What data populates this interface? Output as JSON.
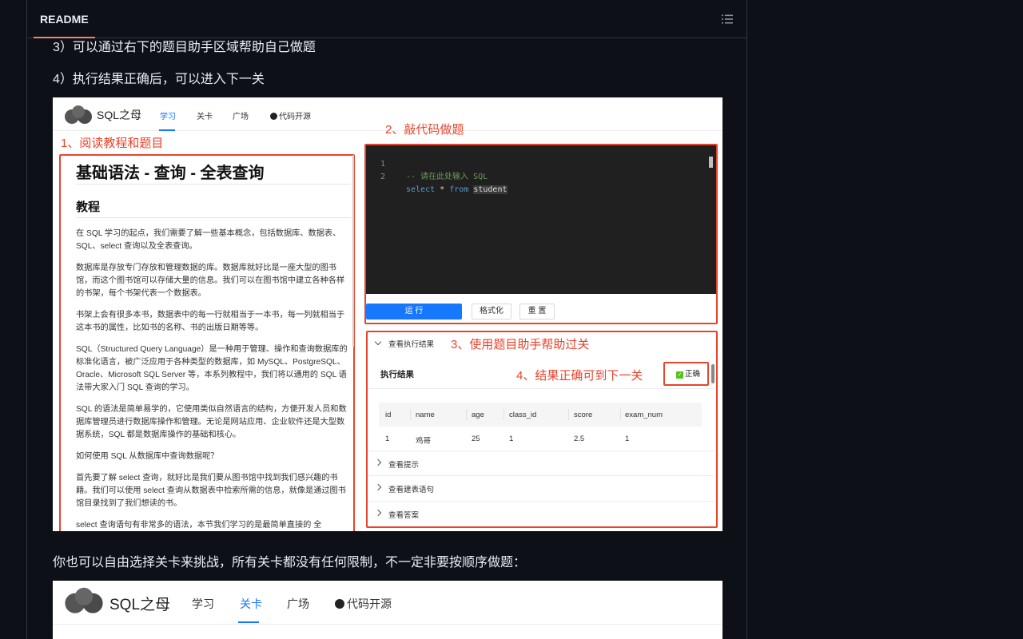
{
  "header": {
    "tab_label": "README",
    "toc_icon": "list-unordered-icon"
  },
  "markdown": {
    "line_3": "3）可以通过右下的题目助手区域帮助自己做题",
    "line_4": "4）执行结果正确后，可以进入下一关",
    "line_free": "你也可以自由选择关卡来挑战，所有关卡都没有任何限制，不一定非要按顺序做题："
  },
  "app1": {
    "logo_text": "SQL之母",
    "nav": [
      "学习",
      "关卡",
      "广场",
      "代码开源"
    ],
    "annotations": {
      "step1": "1、阅读教程和题目",
      "step2": "2、敲代码做题",
      "step3": "3、使用题目助手帮助过关",
      "step4": "4、结果正确可到下一关"
    },
    "tutorial": {
      "title": "基础语法 - 查询 - 全表查询",
      "section": "教程",
      "paragraphs": [
        "在 SQL 学习的起点，我们需要了解一些基本概念，包括数据库、数据表、SQL、select 查询以及全表查询。",
        "数据库是存放专门存放和管理数据的库。数据库就好比是一座大型的图书馆，而这个图书馆可以存储大量的信息。我们可以在图书馆中建立各种各样的书架，每个书架代表一个数据表。",
        "书架上会有很多本书，数据表中的每一行就相当于一本书，每一列就相当于这本书的属性，比如书的名称、书的出版日期等等。",
        "SQL（Structured Query Language）是一种用于管理、操作和查询数据库的标准化语言，被广泛应用于各种类型的数据库，如 MySQL、PostgreSQL、Oracle、Microsoft SQL Server 等，本系列教程中，我们将以通用的 SQL 语法带大家入门 SQL 查询的学习。",
        "SQL 的语法是简单易学的，它使用类似自然语言的结构，方便开发人员和数据库管理员进行数据库操作和管理。无论是网站应用、企业软件还是大型数据系统，SQL 都是数据库操作的基础和核心。",
        "如何使用 SQL 从数据库中查询数据呢？",
        "首先要了解 select 查询，就好比是我们要从图书馆中找到我们感兴趣的书籍。我们可以使用 select 查询从数据表中检索所需的信息，就像是通过图书馆目录找到了我们想读的书。",
        "select 查询语句有非常多的语法，本节我们学习的是最简单直接的 全"
      ]
    },
    "editor": {
      "line_numbers": [
        "1",
        "2"
      ],
      "comment": "-- 请在此处输入 SQL",
      "kw_select": "select",
      "op_star": "*",
      "kw_from": "from",
      "table": "student"
    },
    "buttons": {
      "run": "运 行",
      "format": "格式化",
      "reset": "重 置"
    },
    "helper": {
      "exec_result_toggle": "查看执行结果",
      "result_title": "执行结果",
      "result_status": "正确",
      "columns": [
        "id",
        "name",
        "age",
        "class_id",
        "score",
        "exam_num"
      ],
      "row": [
        "1",
        "鸡哥",
        "25",
        "1",
        "2.5",
        "1"
      ],
      "hint_toggle": "查看提示",
      "create_table_toggle": "查看建表语句",
      "answer_toggle": "查看答案"
    }
  },
  "app2": {
    "logo_text": "SQL之母",
    "nav": [
      "学习",
      "关卡",
      "广场",
      "代码开源"
    ]
  }
}
